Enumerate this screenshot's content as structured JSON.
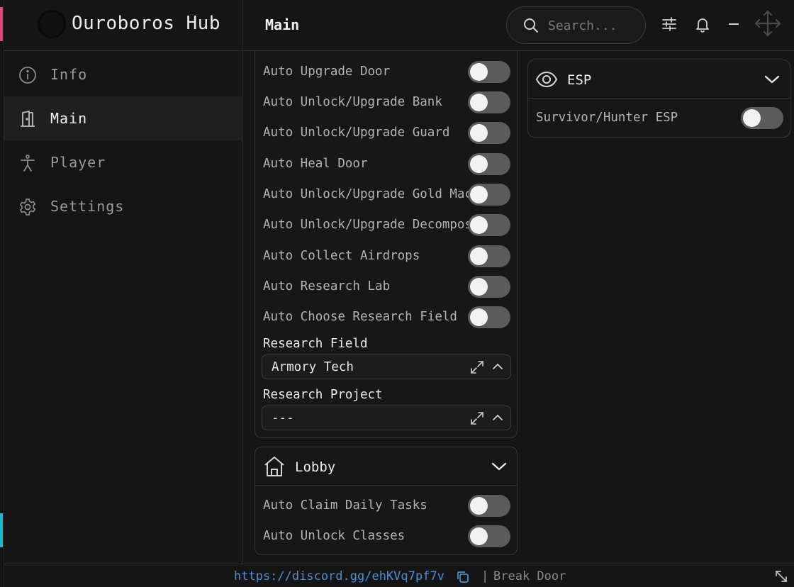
{
  "app": {
    "title": "Ouroboros Hub"
  },
  "header": {
    "section_title": "Main",
    "search_placeholder": "Search..."
  },
  "sidebar": {
    "items": [
      {
        "label": "Info",
        "icon": "info-icon",
        "active": false
      },
      {
        "label": "Main",
        "icon": "door-icon",
        "active": true
      },
      {
        "label": "Player",
        "icon": "person-icon",
        "active": false
      },
      {
        "label": "Settings",
        "icon": "gear-icon",
        "active": false
      }
    ]
  },
  "main_panel": {
    "toggles": [
      {
        "label": "Auto Upgrade Door",
        "on": false
      },
      {
        "label": "Auto Unlock/Upgrade Bank",
        "on": false
      },
      {
        "label": "Auto Unlock/Upgrade Guard",
        "on": false
      },
      {
        "label": "Auto Heal Door",
        "on": false
      },
      {
        "label": "Auto Unlock/Upgrade Gold Mac",
        "on": false
      },
      {
        "label": "Auto Unlock/Upgrade Decompos",
        "on": false
      },
      {
        "label": "Auto Collect Airdrops",
        "on": false
      },
      {
        "label": "Auto Research Lab",
        "on": false
      },
      {
        "label": "Auto Choose Research Field",
        "on": false
      }
    ],
    "research_field": {
      "label": "Research Field",
      "value": "Armory Tech"
    },
    "research_project": {
      "label": "Research Project",
      "value": "---"
    }
  },
  "lobby_panel": {
    "title": "Lobby",
    "icon": "home-icon",
    "toggles": [
      {
        "label": "Auto Claim Daily Tasks",
        "on": false
      },
      {
        "label": "Auto Unlock Classes",
        "on": false
      }
    ]
  },
  "esp_panel": {
    "title": "ESP",
    "icon": "eye-icon",
    "toggles": [
      {
        "label": "Survivor/Hunter ESP",
        "on": false
      }
    ]
  },
  "footer": {
    "link": "https://discord.gg/ehKVq7pf7v",
    "separator": "|",
    "game": "Break Door"
  }
}
